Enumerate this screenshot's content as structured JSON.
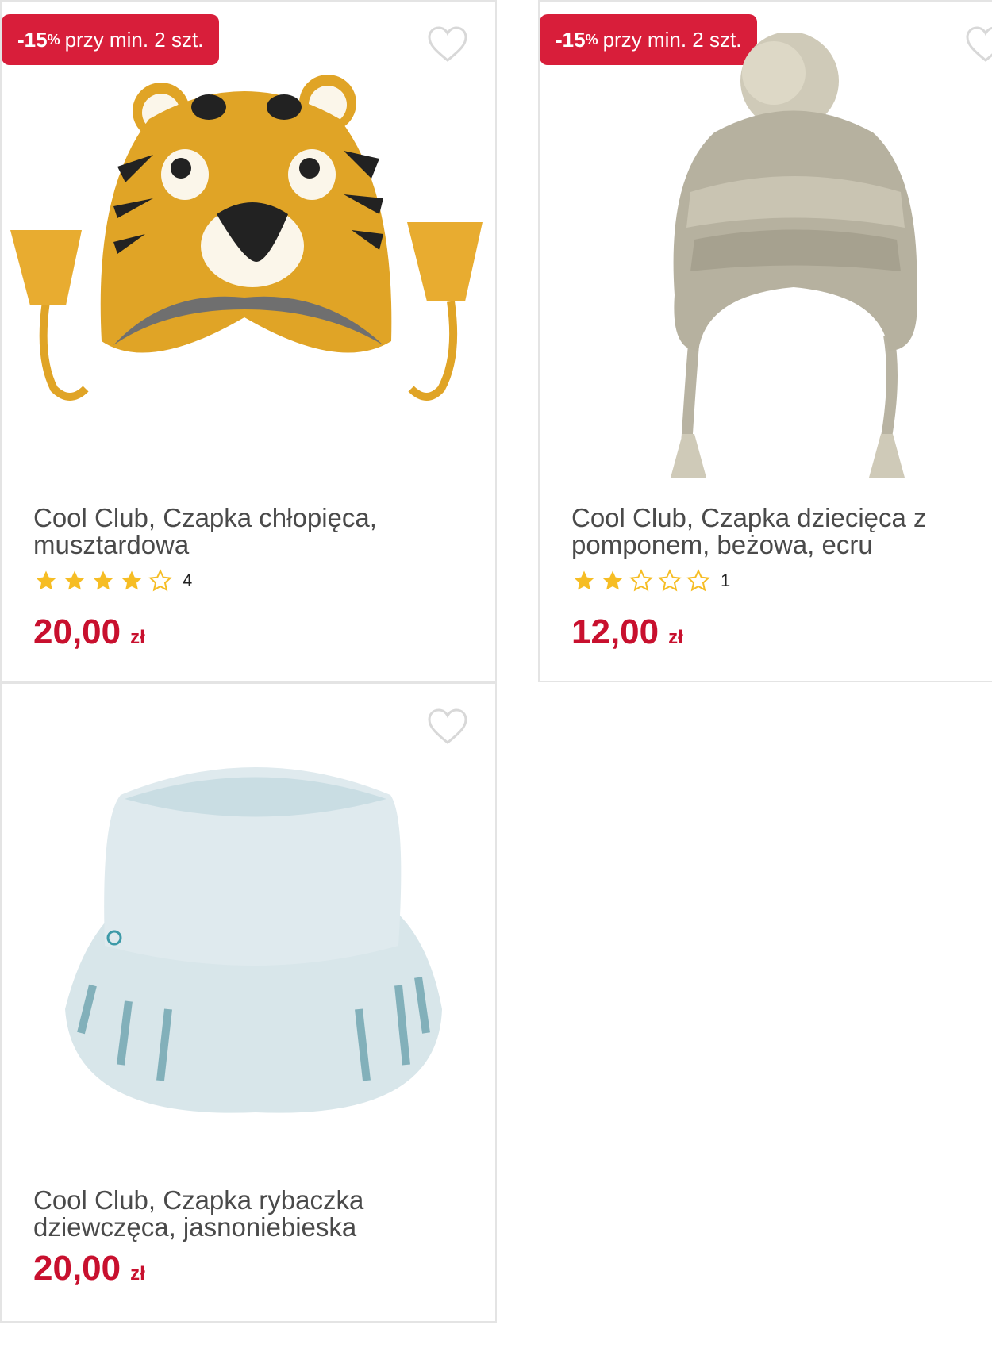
{
  "products": [
    {
      "badge": {
        "percent": "-15",
        "percent_sign": "%",
        "text": "przy min. 2 szt."
      },
      "title": "Cool Club, Czapka chłopięca, musztardowa",
      "rating": {
        "stars_filled": 4,
        "stars_total": 5,
        "count": "4"
      },
      "price": {
        "amount": "20,00",
        "currency": "zł"
      },
      "image": "mustard-tiger-knit-hat"
    },
    {
      "badge": {
        "percent": "-15",
        "percent_sign": "%",
        "text": "przy min. 2 szt."
      },
      "title": "Cool Club, Czapka dziecięca z pomponem, beżowa, ecru",
      "rating": {
        "stars_filled": 2,
        "stars_total": 5,
        "count": "1"
      },
      "price": {
        "amount": "12,00",
        "currency": "zł"
      },
      "image": "beige-pompom-knit-hat"
    },
    {
      "title": "Cool Club, Czapka rybaczka dziewczęca, jasnoniebieska",
      "price": {
        "amount": "20,00",
        "currency": "zł"
      },
      "image": "light-blue-bucket-hat"
    }
  ],
  "colors": {
    "badge": "#d81e3a",
    "price": "#c8102e",
    "star_filled": "#f6bd24",
    "star_empty": "#f6bd24",
    "heart": "#d8d8d8"
  },
  "icons": {
    "favorite": "heart-outline-icon",
    "star": "star-icon"
  }
}
